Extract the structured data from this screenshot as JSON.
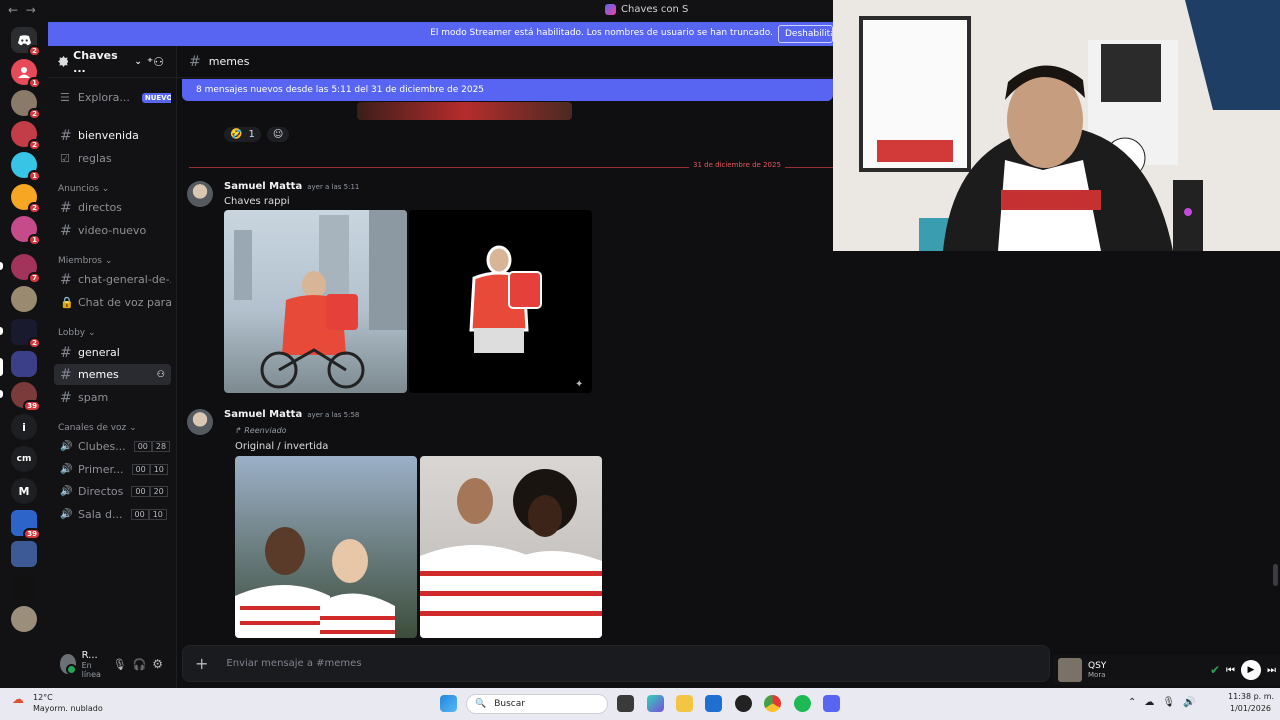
{
  "window": {
    "title": "Chaves con S",
    "back": "←",
    "forward": "→"
  },
  "streamer": {
    "text": "El modo Streamer está habilitado. Los nombres de usuario se han truncado.",
    "button": "Deshabilitar"
  },
  "server": {
    "name": "Chaves ...",
    "explore": "Explora...",
    "nuevo": "NUEVO"
  },
  "server_badges": [
    "2",
    "1",
    "2",
    "2",
    "1",
    "2",
    "1",
    "7",
    "2",
    "39"
  ],
  "server_letters": [
    "i",
    "cm",
    "M"
  ],
  "channels": {
    "top": [
      "bienvenida",
      "reglas"
    ],
    "cat_anuncios": "Anuncios",
    "anuncios": [
      "directos",
      "video-nuevo"
    ],
    "cat_miembros": "Miembros",
    "miembros": [
      "chat-general-de-...",
      "Chat de voz para ..."
    ],
    "cat_lobby": "Lobby",
    "lobby": [
      "general",
      "memes",
      "spam"
    ],
    "cat_voz": "Canales de voz",
    "voz": [
      {
        "name": "Clubes...",
        "a": "00",
        "b": "28"
      },
      {
        "name": "Primer...",
        "a": "00",
        "b": "10"
      },
      {
        "name": "Directos",
        "a": "00",
        "b": "20"
      },
      {
        "name": "Sala d...",
        "a": "00",
        "b": "10"
      }
    ]
  },
  "user": {
    "name": "R...",
    "status": "En línea"
  },
  "chat": {
    "channel": "memes",
    "new_messages": "8 mensajes nuevos desde las 5:11 del 31 de diciembre de 2025",
    "reaction_count": "1",
    "date_divider": "31 de diciembre de 2025",
    "messages": [
      {
        "author": "Samuel Matta",
        "time": "ayer a las 5:11",
        "text": "Chaves rappi"
      },
      {
        "author": "Samuel Matta",
        "time": "ayer a las 5:58",
        "forwarded": "Reenviado",
        "text": "Original / invertida"
      }
    ],
    "placeholder": "Enviar mensaje a #memes"
  },
  "music": {
    "title": "QSY",
    "artist": "Mora"
  },
  "taskbar": {
    "temp": "12°C",
    "weather": "Mayorm. nublado",
    "search": "Buscar",
    "time": "11:38 p. m.",
    "date": "1/01/2026"
  },
  "colors": {
    "blurple": "#5865f2",
    "red": "#da373c",
    "green": "#23a55a"
  }
}
